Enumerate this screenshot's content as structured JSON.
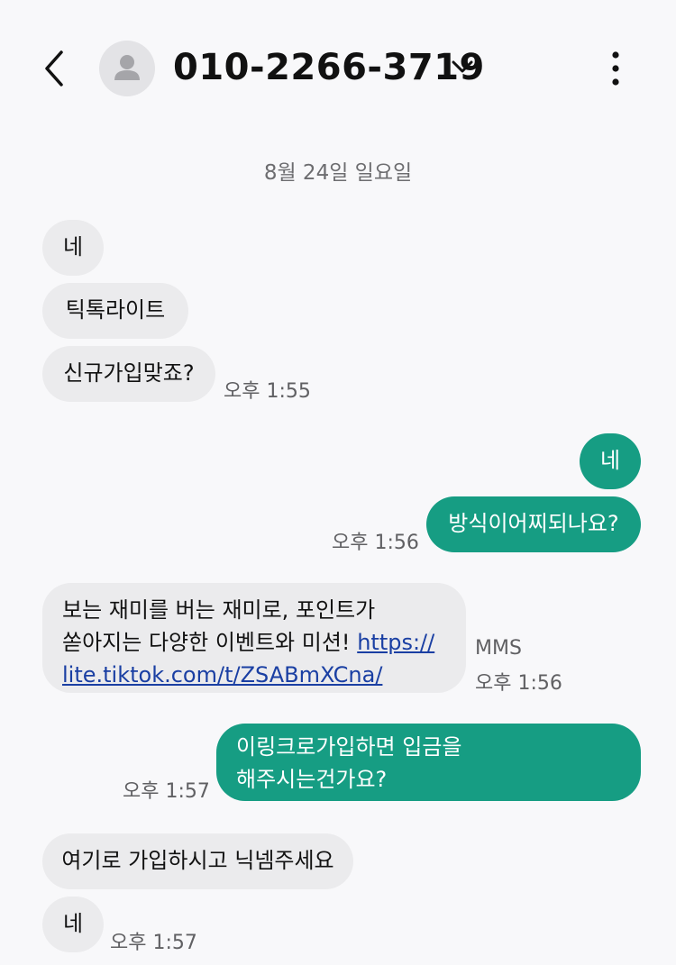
{
  "header": {
    "contact": "010-2266-3719",
    "back_icon": "chevron-left-icon",
    "avatar_icon": "person-icon",
    "more_icon": "vertical-dots-icon"
  },
  "date_separator": "8월 24일 일요일",
  "messages": [
    {
      "direction": "incoming",
      "text": "네"
    },
    {
      "direction": "incoming",
      "text": "틱톡라이트"
    },
    {
      "direction": "incoming",
      "text": "신규가입맞죠?",
      "time": "오후 1:55"
    },
    {
      "direction": "outgoing",
      "text": "네"
    },
    {
      "direction": "outgoing",
      "text": "방식이어찌되나요?",
      "time": "오후 1:56"
    },
    {
      "direction": "incoming",
      "type": "MMS",
      "line1": "보는 재미를 버는 재미로, 포인트가",
      "line2": "쏟아지는 다양한 이벤트와 미션!",
      "link_part1": "https://",
      "link_part2": "lite.tiktok.com/t/ZSABmXCna/",
      "badge": "MMS",
      "time": "오후 1:56"
    },
    {
      "direction": "outgoing",
      "line1": "이링크로가입하면 입금을",
      "line2": "해주시는건가요?",
      "time": "오후 1:57"
    },
    {
      "direction": "incoming",
      "text": "여기로 가입하시고 닉넴주세요"
    },
    {
      "direction": "incoming",
      "text": "네",
      "time": "오후 1:57"
    }
  ],
  "colors": {
    "background": "#f8f8fa",
    "incoming_bubble": "#ebebed",
    "outgoing_bubble": "#169d83",
    "link": "#1a3fa3"
  }
}
